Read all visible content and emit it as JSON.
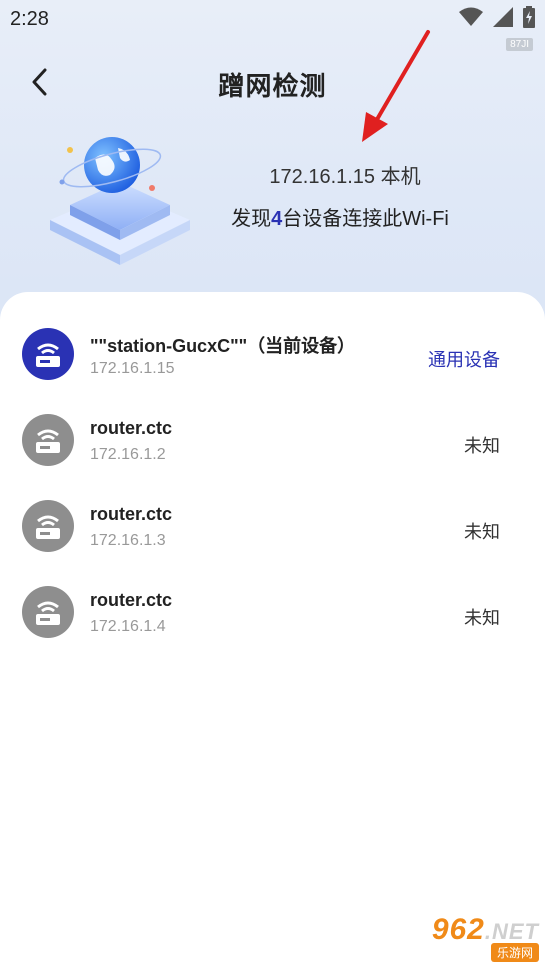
{
  "status_bar": {
    "time": "2:28",
    "badge": "87JI"
  },
  "header": {
    "title": "蹭网检测"
  },
  "summary": {
    "ip_line": "172.16.1.15 本机",
    "found_prefix": "发现",
    "found_count": "4",
    "found_suffix": "台设备连接此Wi-Fi"
  },
  "devices": [
    {
      "name": "\"\"station-GucxC\"\"（当前设备）",
      "ip": "172.16.1.15",
      "type": "通用设备",
      "current": true
    },
    {
      "name": "router.ctc",
      "ip": "172.16.1.2",
      "type": "未知",
      "current": false
    },
    {
      "name": "router.ctc",
      "ip": "172.16.1.3",
      "type": "未知",
      "current": false
    },
    {
      "name": "router.ctc",
      "ip": "172.16.1.4",
      "type": "未知",
      "current": false
    }
  ],
  "watermark": {
    "main": "962",
    "net": ".NET",
    "sub": "乐游网"
  },
  "colors": {
    "accent": "#2a32b4",
    "device_gray": "#8e8e8e",
    "arrow_red": "#e02020"
  },
  "icons": [
    "wifi-icon",
    "signal-icon",
    "battery-icon",
    "back-arrow-icon",
    "globe-icon",
    "router-icon"
  ]
}
